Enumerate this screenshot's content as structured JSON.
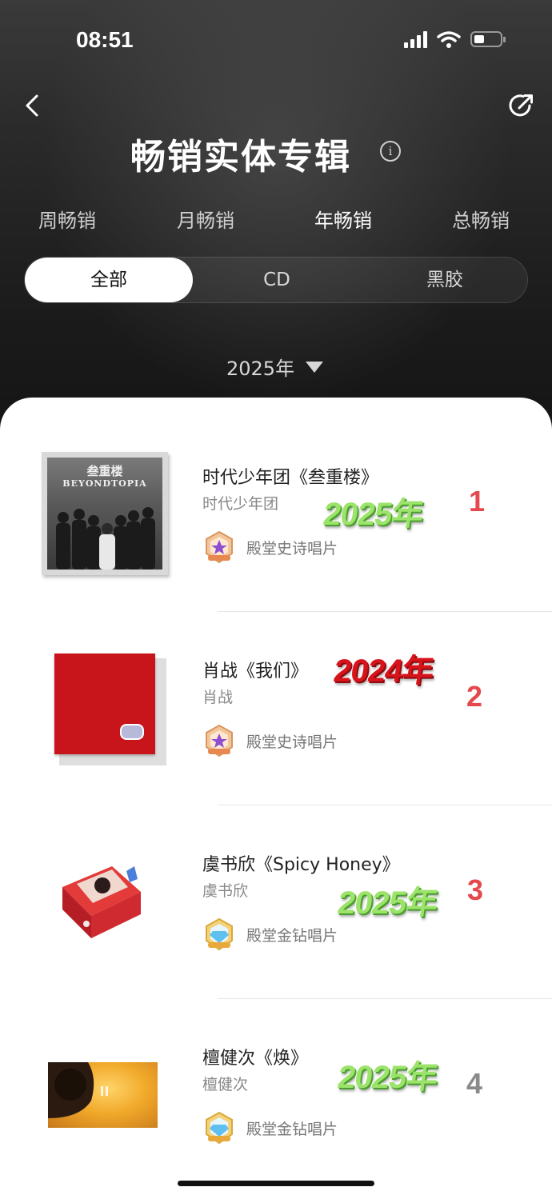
{
  "status_bar": {
    "time": "08:51"
  },
  "header": {
    "title": "畅销实体专辑",
    "info_symbol": "i"
  },
  "period_tabs": [
    {
      "label": "周畅销",
      "active": false
    },
    {
      "label": "月畅销",
      "active": false
    },
    {
      "label": "年畅销",
      "active": true
    },
    {
      "label": "总畅销",
      "active": false
    }
  ],
  "format_filter": [
    {
      "label": "全部",
      "active": true
    },
    {
      "label": "CD",
      "active": false
    },
    {
      "label": "黑胶",
      "active": false
    }
  ],
  "year_selector": {
    "value": "2025年"
  },
  "albums": [
    {
      "rank": "1",
      "rank_color": "#e5484d",
      "title": "时代少年团《叁重楼》",
      "artist": "时代少年团",
      "badge": "殿堂史诗唱片",
      "badge_icon": "epic-badge-icon",
      "cover_title": "叁重楼",
      "cover_subtitle": "BEYONDTOPIA",
      "overlay_year": "2025年",
      "overlay_color": "green"
    },
    {
      "rank": "2",
      "rank_color": "#e5484d",
      "title": "肖战《我们》",
      "artist": "肖战",
      "badge": "殿堂史诗唱片",
      "badge_icon": "epic-badge-icon",
      "overlay_year": "2024年",
      "overlay_color": "red"
    },
    {
      "rank": "3",
      "rank_color": "#e5484d",
      "title": "虞书欣《Spicy Honey》",
      "artist": "虞书欣",
      "badge": "殿堂金钻唱片",
      "badge_icon": "diamond-badge-icon",
      "overlay_year": "2025年",
      "overlay_color": "green"
    },
    {
      "rank": "4",
      "rank_color": "#8a8a8a",
      "title": "檀健次《焕》",
      "artist": "檀健次",
      "badge": "殿堂金钻唱片",
      "badge_icon": "diamond-badge-icon",
      "overlay_year": "2025年",
      "overlay_color": "green"
    }
  ]
}
